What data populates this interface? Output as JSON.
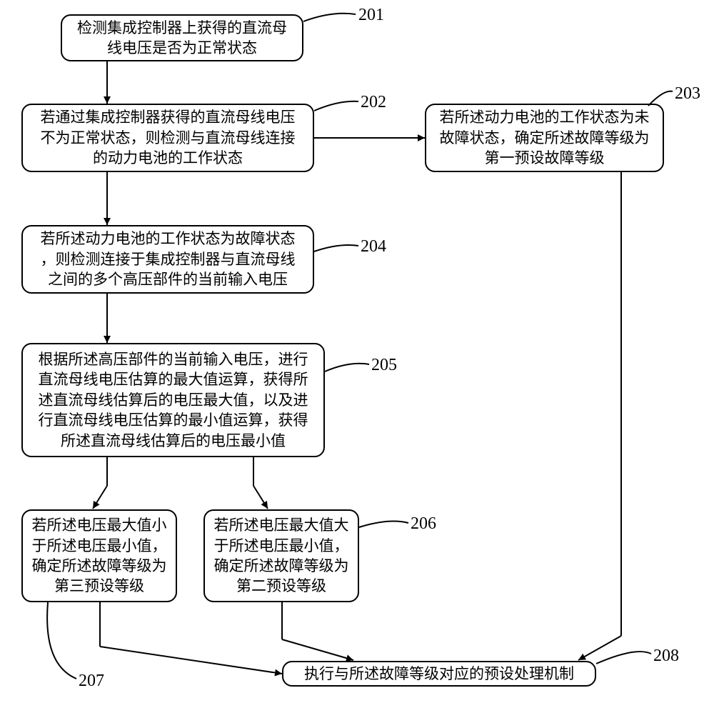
{
  "boxes": {
    "b201": "检测集成控制器上获得的直流母\n线电压是否为正常状态",
    "b202": "若通过集成控制器获得的直流母线电压\n不为正常状态，则检测与直流母线连接\n的动力电池的工作状态",
    "b203": "若所述动力电池的工作状态为未\n故障状态，确定所述故障等级为\n第一预设故障等级",
    "b204": "若所述动力电池的工作状态为故障状态\n，则检测连接于集成控制器与直流母线\n之间的多个高压部件的当前输入电压",
    "b205": "根据所述高压部件的当前输入电压，进行\n直流母线电压估算的最大值运算，获得所\n述直流母线估算后的电压最大值，以及进\n行直流母线电压估算的最小值运算，获得\n所述直流母线估算后的电压最小值",
    "b206": "若所述电压最大值大\n于所述电压最小值，\n确定所述故障等级为\n第二预设等级",
    "b207": "若所述电压最大值小\n于所述电压最小值，\n确定所述故障等级为\n第三预设等级",
    "b208": "执行与所述故障等级对应的预设处理机制"
  },
  "labels": {
    "l201": "201",
    "l202": "202",
    "l203": "203",
    "l204": "204",
    "l205": "205",
    "l206": "206",
    "l207": "207",
    "l208": "208"
  }
}
